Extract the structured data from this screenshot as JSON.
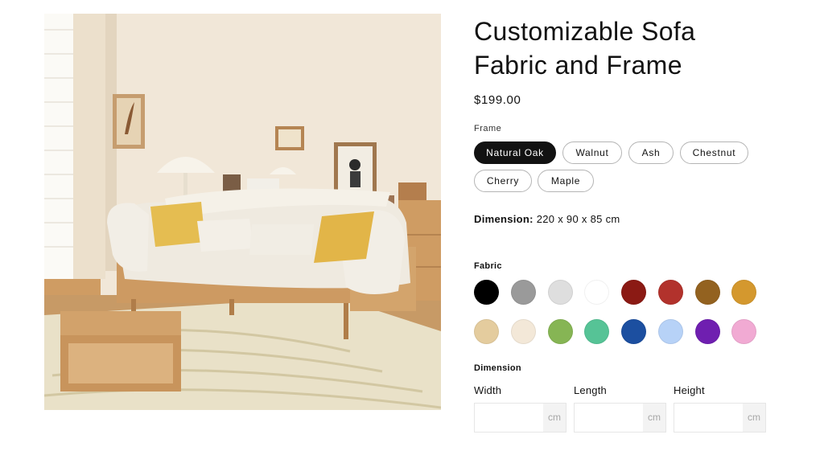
{
  "product": {
    "title": "Customizable Sofa Fabric and Frame",
    "price": "$199.00",
    "image_alt": "cream sofa with wooden frame in a living room"
  },
  "frame": {
    "label": "Frame",
    "options": [
      "Natural Oak",
      "Walnut",
      "Ash",
      "Chestnut",
      "Cherry",
      "Maple"
    ],
    "selected": "Natural Oak"
  },
  "dimension_summary": {
    "label": "Dimension:",
    "value": "220 x 90 x 85 cm"
  },
  "fabric": {
    "label": "Fabric",
    "swatches": [
      "#000000",
      "#9a9a9a",
      "#dedede",
      "#ffffff",
      "#8b1a14",
      "#b2322c",
      "#936220",
      "#d4982e",
      "#e4cc9e",
      "#f3e8d8",
      "#86b554",
      "#56c396",
      "#1c4fa0",
      "#b7d2f7",
      "#6f1fb0",
      "#f1aad3"
    ]
  },
  "dimension_inputs": {
    "label": "Dimension",
    "fields": [
      {
        "label": "Width",
        "unit": "cm",
        "value": ""
      },
      {
        "label": "Length",
        "unit": "cm",
        "value": ""
      },
      {
        "label": "Height",
        "unit": "cm",
        "value": ""
      }
    ]
  },
  "icons": [
    "product-image"
  ]
}
